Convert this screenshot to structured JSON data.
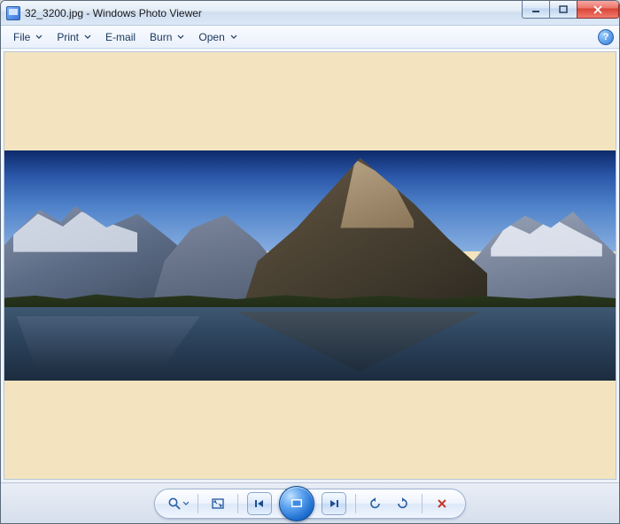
{
  "window": {
    "title": "32_3200.jpg - Windows Photo Viewer"
  },
  "menu": {
    "file": "File",
    "print": "Print",
    "email": "E-mail",
    "burn": "Burn",
    "open": "Open"
  },
  "controls": {
    "zoom": "Change the display size",
    "fit": "Fit to window",
    "prev": "Previous",
    "slideshow": "Play slide show",
    "next": "Next",
    "rotate_ccw": "Rotate counterclockwise",
    "rotate_cw": "Rotate clockwise",
    "delete": "Delete"
  }
}
